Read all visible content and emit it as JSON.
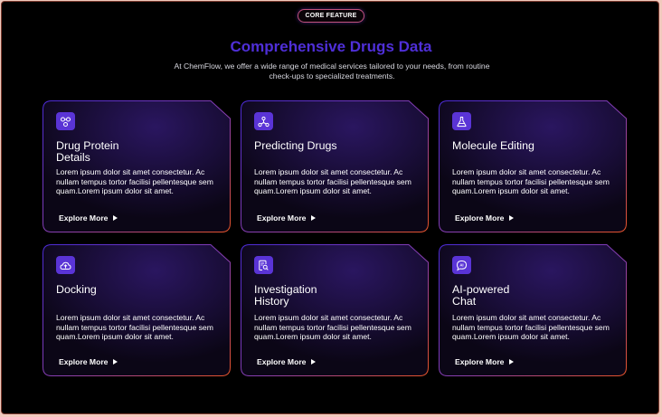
{
  "header": {
    "badge": "CORE FEATURE",
    "title": "Comprehensive Drugs Data",
    "subtitle": "At ChemFlow, we offer a wide range of medical services tailored to your needs, from routine check-ups to specialized treatments."
  },
  "colors": {
    "accent": "#4f2fd8",
    "icon_bg": "#5a34d6",
    "border_start": "#4b2bd6",
    "border_end": "#e8542a"
  },
  "cards": [
    {
      "title": "Drug Protein Details",
      "desc": "Lorem ipsum dolor sit amet consectetur. Ac nullam tempus tortor facilisi pellentesque sem quam.Lorem ipsum dolor sit amet.",
      "link": "Explore More",
      "icon": "molecule-bond-icon"
    },
    {
      "title": "Predicting Drugs",
      "desc": "Lorem ipsum dolor sit amet consectetur. Ac nullam tempus tortor facilisi pellentesque sem quam.Lorem ipsum dolor sit amet.",
      "link": "Explore More",
      "icon": "network-nodes-icon"
    },
    {
      "title": "Molecule Editing",
      "desc": "Lorem ipsum dolor sit amet consectetur. Ac nullam tempus tortor facilisi pellentesque sem quam.Lorem ipsum dolor sit amet.",
      "link": "Explore More",
      "icon": "flask-icon"
    },
    {
      "title": "Docking",
      "desc": "Lorem ipsum dolor sit amet consectetur. Ac nullam tempus tortor facilisi pellentesque sem quam.Lorem ipsum dolor sit amet.",
      "link": "Explore More",
      "icon": "cloud-upload-icon"
    },
    {
      "title": "Investigation History",
      "desc": "Lorem ipsum dolor sit amet consectetur. Ac nullam tempus tortor facilisi pellentesque sem quam.Lorem ipsum dolor sit amet.",
      "link": "Explore More",
      "icon": "document-search-icon"
    },
    {
      "title": "AI-powered Chat",
      "desc": "Lorem ipsum dolor sit amet consectetur. Ac nullam tempus tortor facilisi pellentesque sem quam.Lorem ipsum dolor sit amet.",
      "link": "Explore More",
      "icon": "ai-chat-icon"
    }
  ]
}
